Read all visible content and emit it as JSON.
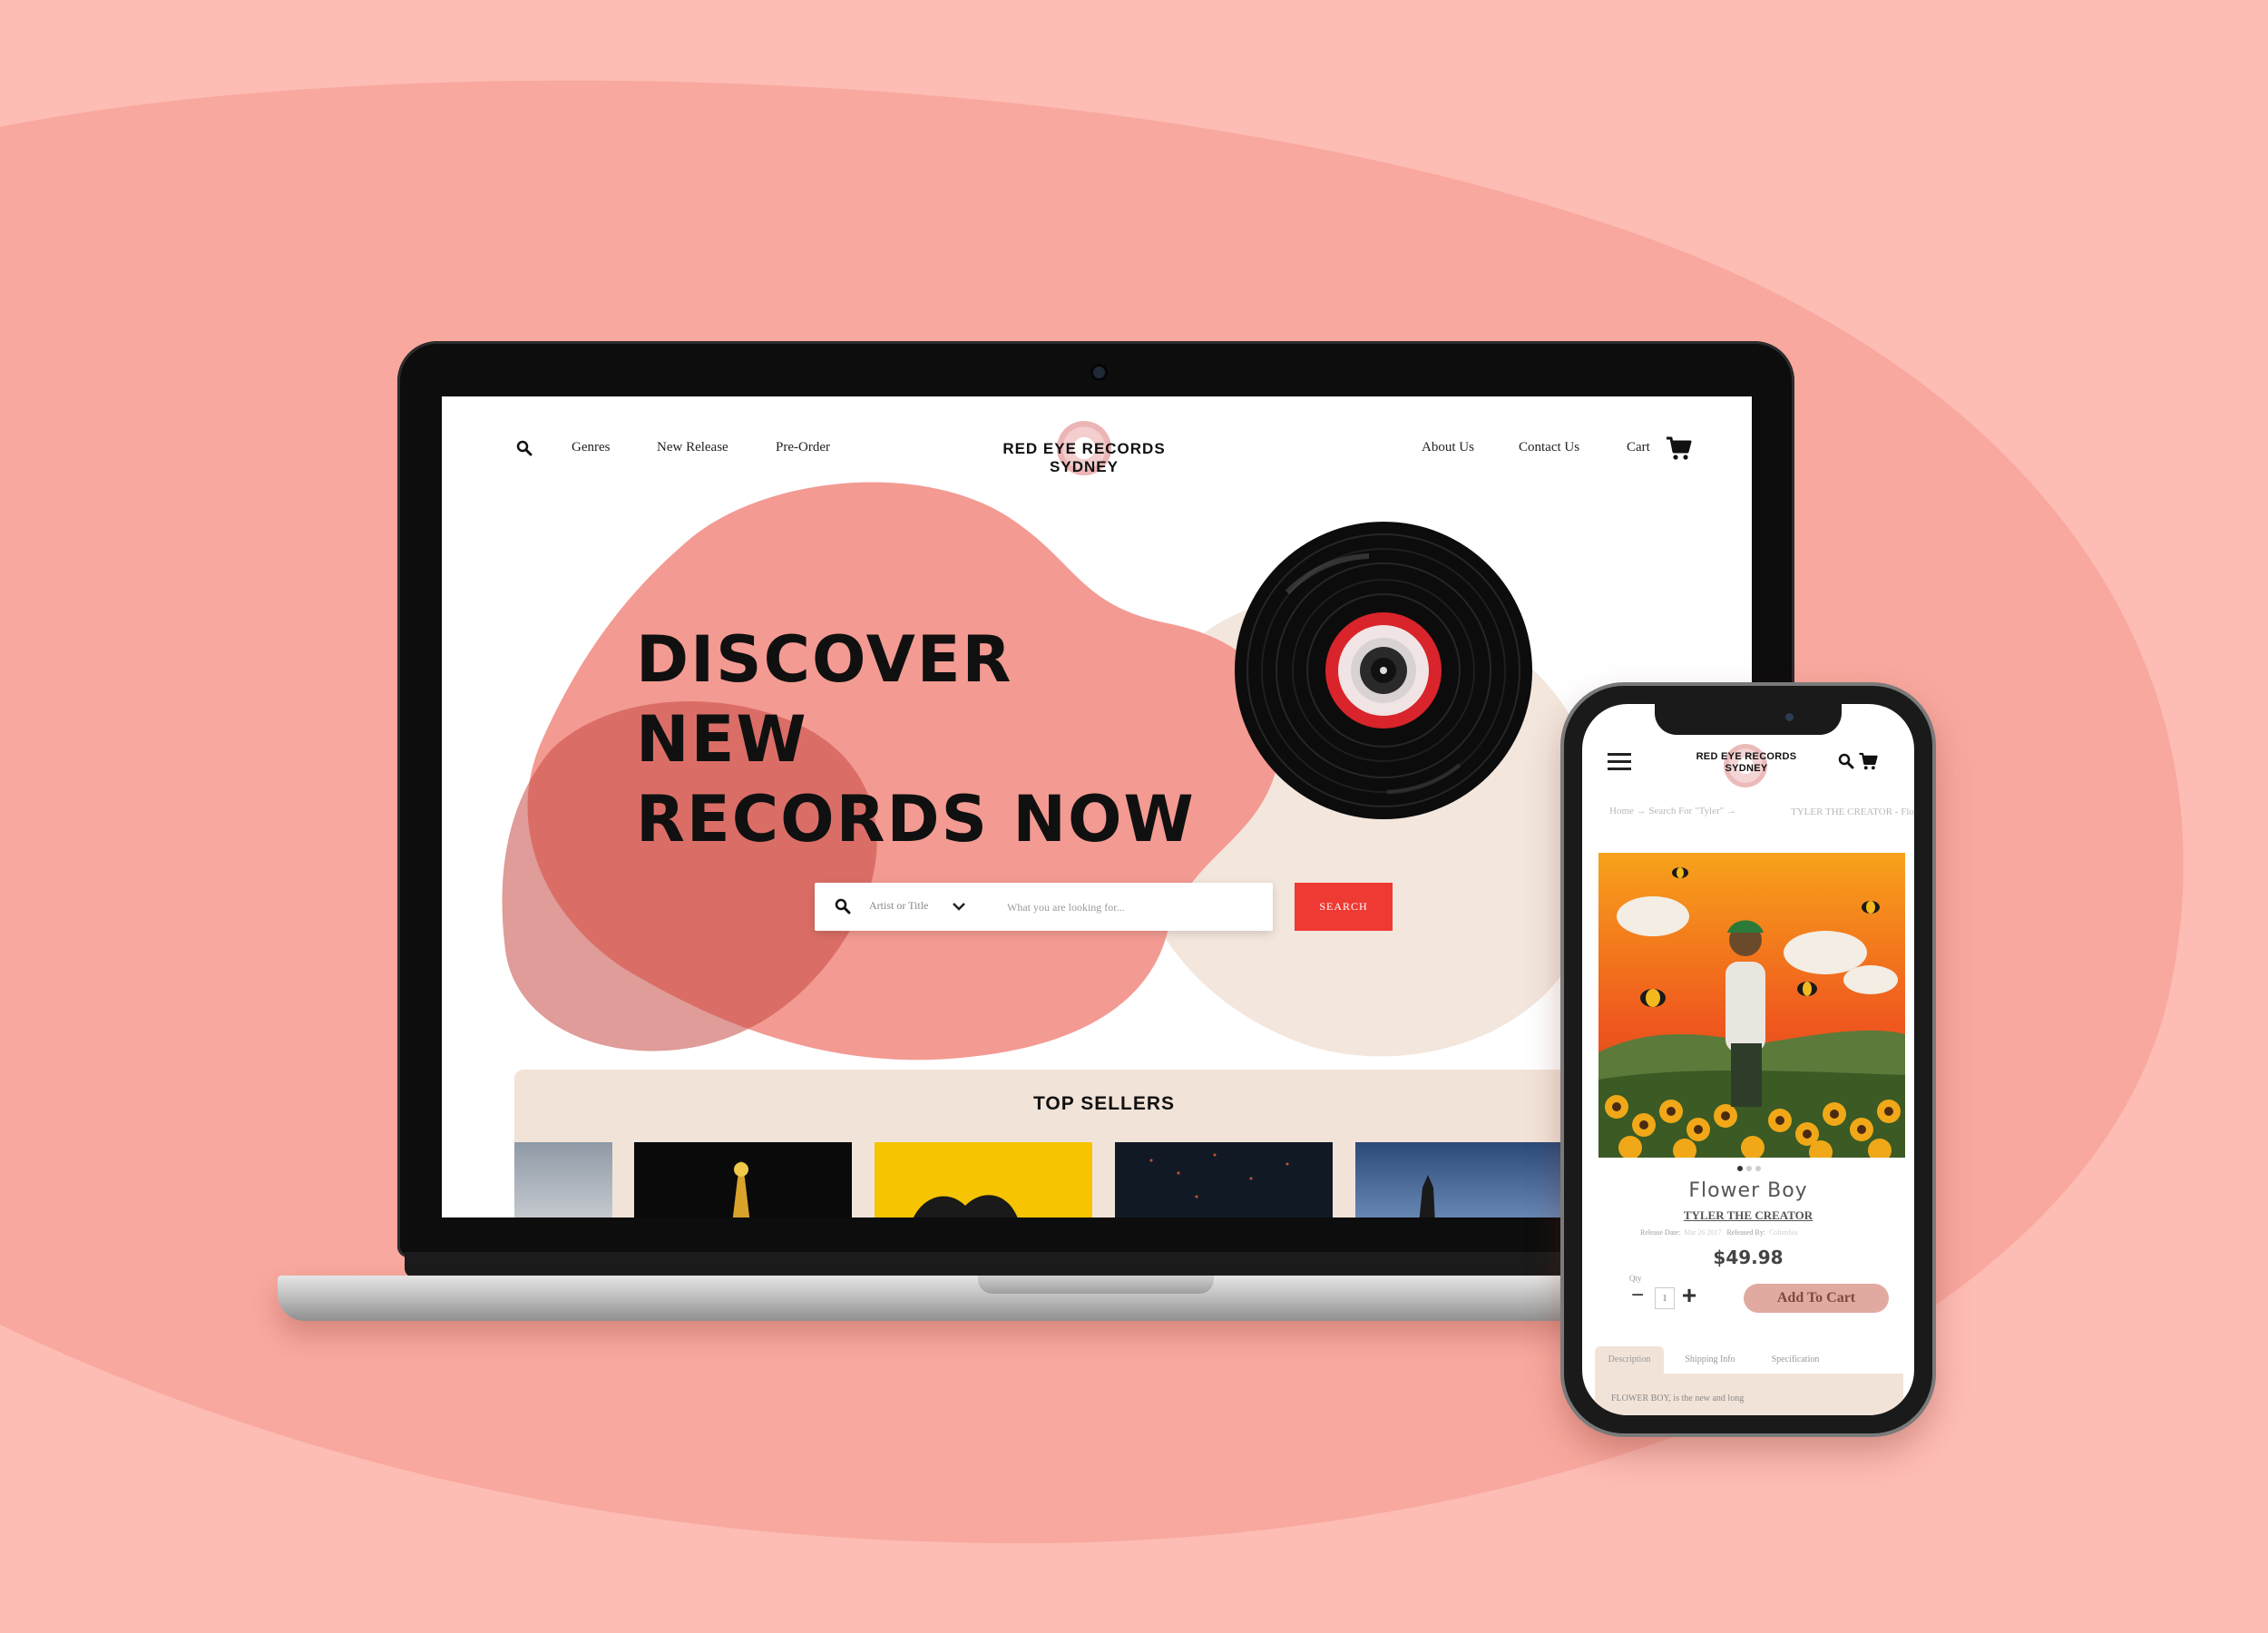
{
  "colors": {
    "background": "#fdbcb4",
    "background_blob": "#f8a89e",
    "accent_red": "#ee3a33",
    "blob_pink": "#f39a92",
    "blob_cream": "#f3e6dd",
    "top_sellers_bg": "#f2e3d8",
    "add_to_cart": "#e1aaa0"
  },
  "desktop": {
    "nav": {
      "search_icon": "search-icon",
      "left_links": [
        "Genres",
        "New Release",
        "Pre-Order"
      ],
      "logo": "RED EYE RECORDS SYDNEY",
      "right_links": [
        "About Us",
        "Contact Us",
        "Cart"
      ],
      "cart_icon": "cart-icon"
    },
    "hero": {
      "title_lines": [
        "DISCOVER",
        "NEW",
        "RECORDS NOW"
      ]
    },
    "search": {
      "filter_label": "Artist or Title",
      "placeholder": "What you are looking for...",
      "button_label": "SEARCH"
    },
    "top_sellers": {
      "title": "TOP SELLERS"
    }
  },
  "mobile": {
    "logo": "RED EYE RECORDS SYDNEY",
    "breadcrumb": {
      "items": [
        "Home",
        "Search For \"Tyler\""
      ],
      "separator": "→",
      "current": "TYLER THE CREATOR - Flower Boy"
    },
    "product": {
      "title": "Flower Boy",
      "artist": "TYLER THE CREATOR",
      "release_date_label": "Release Date:",
      "release_date": "Mar 26 2017",
      "released_by_label": "Released By:",
      "released_by": "Columbia",
      "price": "$49.98",
      "qty_label": "Qty",
      "qty": "1",
      "add_to_cart": "Add To Cart"
    },
    "tabs": [
      "Description",
      "Shipping Info",
      "Specification"
    ],
    "description": "FLOWER BOY, is the new and long"
  }
}
